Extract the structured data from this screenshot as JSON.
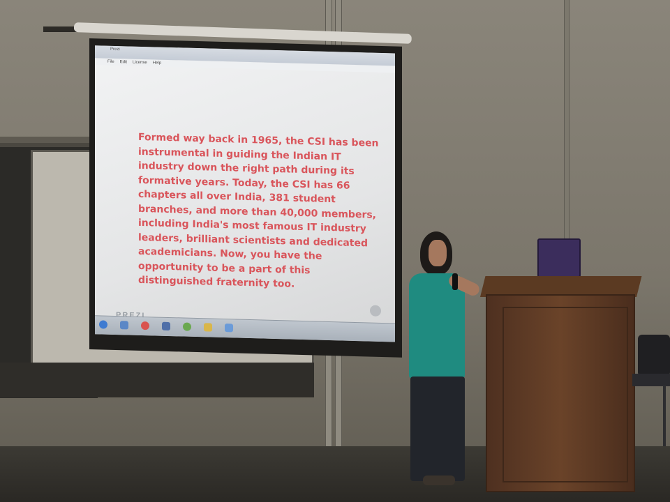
{
  "scene": {
    "description_color_wall": "#7b766b",
    "accent_slide_text": "#d9555b"
  },
  "projection": {
    "menu": [
      "File",
      "Edit",
      "License",
      "Help"
    ],
    "slide_text": "Formed way back in 1965, the CSI has been instrumental in guiding the Indian IT industry down the right path during its formative years. Today, the CSI has 66 chapters all over India, 381 student branches, and more than 40,000 members, including India's most famous IT industry leaders, brilliant scientists and dedicated academicians. Now, you have the opportunity to be a part of this distinguished fraternity too.",
    "logo_text": "PREZI"
  },
  "icons": {
    "taskbar": [
      "windows-start-icon",
      "browser-icon",
      "chrome-icon",
      "app-icon",
      "utorrent-icon",
      "folder-icon",
      "app-icon-2"
    ]
  }
}
